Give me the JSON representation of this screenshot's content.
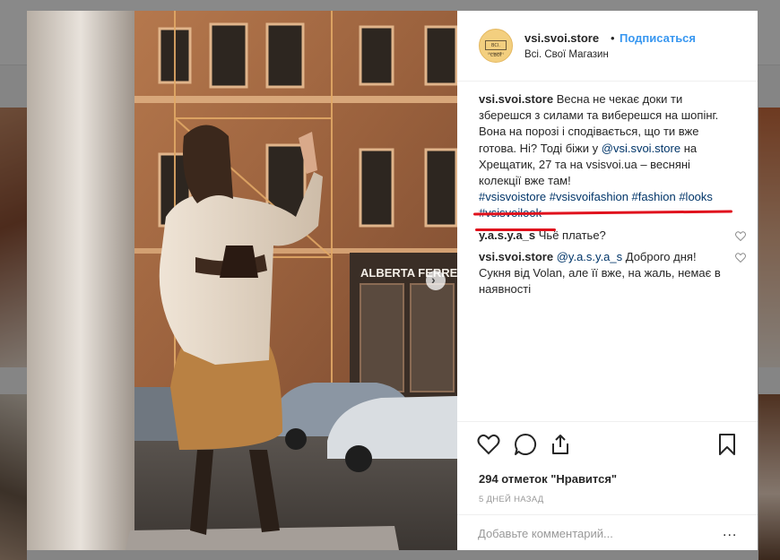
{
  "post": {
    "username": "vsi.svoi.store",
    "separator": "•",
    "follow_label": "Подписаться",
    "subtitle": "Всі. Свої Магазин"
  },
  "avatar": {
    "logo_text": "ВСІ. СВОЇ",
    "logo_sub": "МАГАЗИН"
  },
  "caption": {
    "author": "vsi.svoi.store",
    "text1": "Весна не чекає доки ти зберешся з силами та виберешся на шопінг. Вона на порозі і сподівається, що ти вже готова. Ні? Тоді біжи у ",
    "mention": "@vsi.svoi.store",
    "text2": " на Хрещатик, 27 та на vsisvoi.ua – весняні колекції вже там!",
    "tags": [
      "#vsisvoistore",
      "#vsisvoifashion",
      "#fashion",
      "#looks",
      "#vsisvoilook"
    ]
  },
  "comments": [
    {
      "author": "y.a.s.y.a_s",
      "text": " Чьё платье?"
    },
    {
      "author": "vsi.svoi.store",
      "mention": "@y.a.s.y.a_s",
      "text": " Доброго дня! Сукня від Volan, але її вже, на жаль, немає в наявності"
    }
  ],
  "photo": {
    "sign_text": "ALBERTA FERRE"
  },
  "likes_text": "294 отметок \"Нравится\"",
  "time_ago": "5 ДНЕЙ НАЗАД",
  "add_comment_placeholder": "Добавьте комментарий...",
  "more_label": "...",
  "next_label": "›",
  "icons": [
    "heart-icon",
    "comment-icon",
    "share-icon",
    "bookmark-icon",
    "chevron-right-icon",
    "small-heart-icon"
  ],
  "colors": {
    "link": "#3897f0",
    "highlight": "#e0121d",
    "text": "#262626",
    "muted": "#999999"
  }
}
